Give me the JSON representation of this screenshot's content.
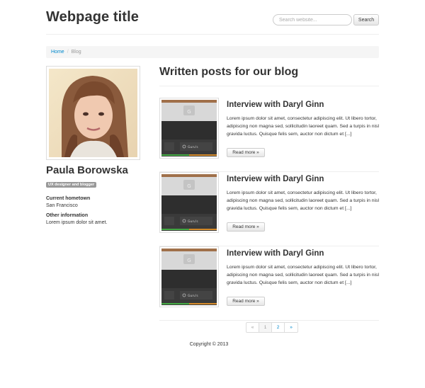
{
  "header": {
    "title": "Webpage title",
    "search_placeholder": "Search website...",
    "search_button": "Search"
  },
  "breadcrumb": {
    "items": [
      {
        "label": "Home",
        "link": true
      },
      {
        "label": "Blog",
        "link": false
      }
    ],
    "separator": "/"
  },
  "profile": {
    "name": "Paula Borowska",
    "role": "UX designer and blogger",
    "hometown_label": "Current hometown",
    "hometown_value": "San Francisco",
    "other_label": "Other information",
    "other_value": "Lorem ipsum dolor sit amet."
  },
  "main": {
    "heading": "Written posts for our blog",
    "posts": [
      {
        "title": "Interview with Daryl Ginn",
        "excerpt": "Lorem ipsum dolor sit amet, consectetur adipiscing elit. Ut libero tortor, adipiscing non magna sed, sollicitudin laoreet quam. Sed a turpis in nisl gravida luctus. Quisque felis sem, auctor non dictum et [...]",
        "read_more": "Read more »",
        "thumb_label": "Guru's"
      },
      {
        "title": "Interview with Daryl Ginn",
        "excerpt": "Lorem ipsum dolor sit amet, consectetur adipiscing elit. Ut libero tortor, adipiscing non magna sed, sollicitudin laoreet quam. Sed a turpis in nisl gravida luctus. Quisque felis sem, auctor non dictum et [...]",
        "read_more": "Read more »",
        "thumb_label": "Guru's"
      },
      {
        "title": "Interview with Daryl Ginn",
        "excerpt": "Lorem ipsum dolor sit amet, consectetur adipiscing elit. Ut libero tortor, adipiscing non magna sed, sollicitudin laoreet quam. Sed a turpis in nisl gravida luctus. Quisque felis sem, auctor non dictum et [...]",
        "read_more": "Read more »",
        "thumb_label": "Guru's"
      }
    ]
  },
  "pagination": {
    "prev": "«",
    "pages": [
      "1",
      "2"
    ],
    "current": "1",
    "next": "»"
  },
  "footer": {
    "copyright": "Copyright © 2013"
  },
  "colors": {
    "link": "#0088cc",
    "badge": "#999999",
    "breadcrumb_bg": "#f5f5f5"
  }
}
